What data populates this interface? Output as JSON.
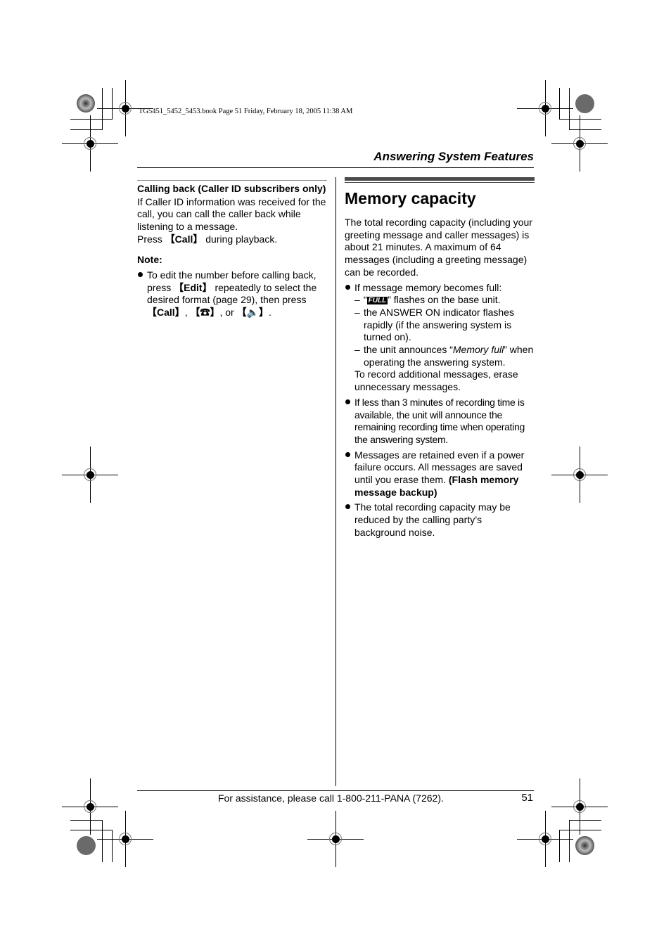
{
  "slug_line": "TG5451_5452_5453.book  Page 51  Friday, February 18, 2005  11:38 AM",
  "header": {
    "section_title": "Answering System Features"
  },
  "left_column": {
    "subheading": "Calling back (Caller ID subscribers only)",
    "paragraph": "If Caller ID information was received for the call, you can call the caller back while listening to a message.",
    "press_prefix": "Press ",
    "press_key": "【Call】",
    "press_suffix": " during playback.",
    "note_label": "Note:",
    "note_bullet": {
      "text_1": "To edit the number before calling back, press ",
      "key_edit": "【Edit】",
      "text_2": " repeatedly to select the desired format (page 29), then press ",
      "key_call": "【Call】",
      "text_3": ", ",
      "key_talk": "【☎】",
      "text_4": ", or ",
      "key_speaker": "【🔈】",
      "text_5": "."
    }
  },
  "right_column": {
    "title": "Memory capacity",
    "intro": "The total recording capacity (including your greeting message and caller messages) is about 21 minutes. A maximum of 64 messages (including a greeting message) can be recorded.",
    "bullet_1": {
      "lead": "If message memory becomes full:",
      "dash_1_pre": "“",
      "dash_1_badge": "FULL",
      "dash_1_post": "” flashes on the base unit.",
      "dash_2": "the ANSWER ON indicator flashes rapidly (if the answering system is turned on).",
      "dash_3_pre": "the unit announces “",
      "dash_3_italic": "Memory full",
      "dash_3_post": "” when operating the answering system.",
      "followup": "To record additional messages, erase unnecessary messages."
    },
    "bullet_2": "If less than 3 minutes of recording time is available, the unit will announce the remaining recording time when operating the answering system.",
    "bullet_3": {
      "text": "Messages are retained even if a power failure occurs. All messages are saved until you erase them. ",
      "bold": "(Flash memory message backup)"
    },
    "bullet_4": "The total recording capacity may be reduced by the calling party’s background noise."
  },
  "footer": {
    "assistance": "For assistance, please call 1-800-211-PANA (7262).",
    "page_number": "51"
  }
}
